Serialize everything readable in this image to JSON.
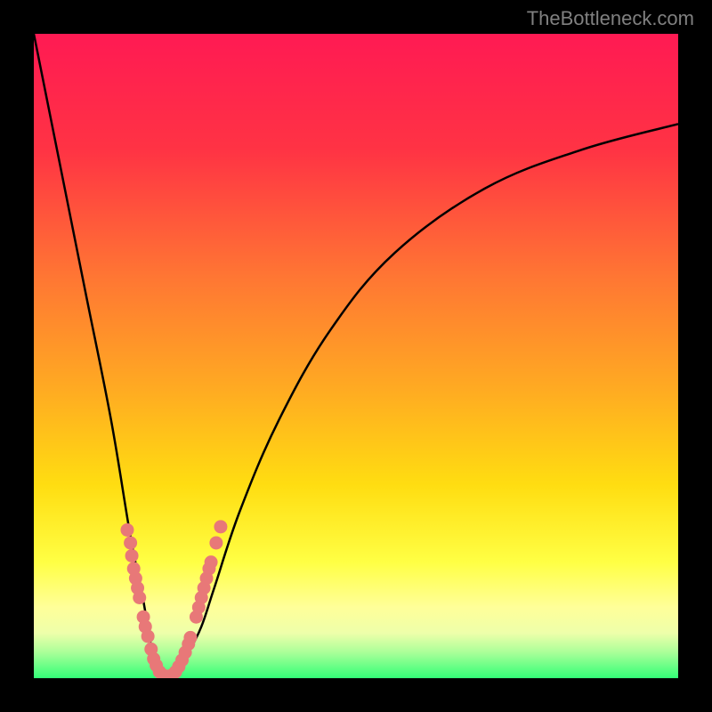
{
  "watermark": "TheBottleneck.com",
  "chart_data": {
    "type": "line",
    "title": "",
    "xlabel": "",
    "ylabel": "",
    "xlim": [
      0,
      100
    ],
    "ylim": [
      0,
      100
    ],
    "gradient_colors": {
      "top": "#ff1a53",
      "upper_mid": "#ff6633",
      "mid": "#ffcc00",
      "lower_mid": "#ffff66",
      "bottom": "#33ff66"
    },
    "series": [
      {
        "name": "main-curve",
        "description": "V-shaped curve with minimum near x=20, left branch steep, right branch gradual asymptotic",
        "x": [
          0,
          4,
          8,
          12,
          15,
          17,
          18,
          19,
          20,
          21,
          22,
          24,
          26,
          28,
          32,
          38,
          46,
          56,
          70,
          85,
          100
        ],
        "y": [
          100,
          80,
          60,
          40,
          22,
          12,
          6,
          2,
          0,
          0,
          1,
          4,
          8,
          14,
          26,
          40,
          54,
          66,
          76,
          82,
          86
        ]
      }
    ],
    "marker_clusters": [
      {
        "name": "left-branch-markers",
        "color": "#e87878",
        "points": [
          {
            "x": 14.5,
            "y": 23
          },
          {
            "x": 15,
            "y": 21
          },
          {
            "x": 15.2,
            "y": 19
          },
          {
            "x": 15.5,
            "y": 17
          },
          {
            "x": 15.8,
            "y": 15.5
          },
          {
            "x": 16.1,
            "y": 14
          },
          {
            "x": 16.4,
            "y": 12.5
          },
          {
            "x": 17,
            "y": 9.5
          },
          {
            "x": 17.3,
            "y": 8
          },
          {
            "x": 17.7,
            "y": 6.5
          },
          {
            "x": 18.2,
            "y": 4.5
          },
          {
            "x": 18.6,
            "y": 3
          },
          {
            "x": 19,
            "y": 2
          },
          {
            "x": 19.5,
            "y": 1
          },
          {
            "x": 20,
            "y": 0.5
          },
          {
            "x": 20.5,
            "y": 0.3
          },
          {
            "x": 21,
            "y": 0.3
          }
        ]
      },
      {
        "name": "right-branch-markers",
        "color": "#e87878",
        "points": [
          {
            "x": 21.5,
            "y": 0.5
          },
          {
            "x": 22,
            "y": 1
          },
          {
            "x": 22.5,
            "y": 1.8
          },
          {
            "x": 23,
            "y": 2.8
          },
          {
            "x": 23.5,
            "y": 4
          },
          {
            "x": 24,
            "y": 5.3
          },
          {
            "x": 24.3,
            "y": 6.3
          },
          {
            "x": 25.2,
            "y": 9.5
          },
          {
            "x": 25.6,
            "y": 11
          },
          {
            "x": 26,
            "y": 12.5
          },
          {
            "x": 26.4,
            "y": 14
          },
          {
            "x": 26.8,
            "y": 15.5
          },
          {
            "x": 27.2,
            "y": 17
          },
          {
            "x": 27.5,
            "y": 18
          },
          {
            "x": 28.3,
            "y": 21
          },
          {
            "x": 29,
            "y": 23.5
          }
        ]
      }
    ]
  }
}
